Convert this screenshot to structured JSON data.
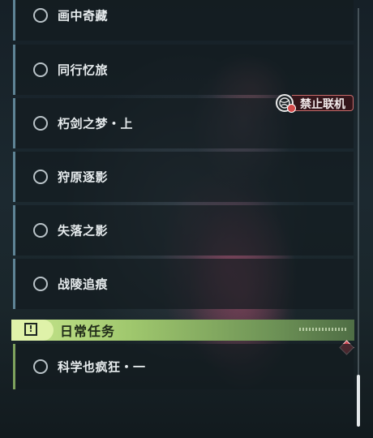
{
  "quests": [
    {
      "label": "画中奇藏"
    },
    {
      "label": "同行忆旅"
    },
    {
      "label": "朽剑之梦・上"
    },
    {
      "label": "狩原逐影"
    },
    {
      "label": "失落之影"
    },
    {
      "label": "战陵追痕"
    }
  ],
  "section": {
    "title": "日常任务",
    "icon": "exclamation-icon"
  },
  "daily_quests": [
    {
      "label": "科学也疯狂・一"
    }
  ],
  "multiplayer_tag": {
    "label": "禁止联机",
    "icon": "globe-no-coop-icon"
  },
  "colors": {
    "accent_blue": "#5f8496",
    "accent_green": "#9fc76d",
    "warning_red": "#d54652"
  }
}
